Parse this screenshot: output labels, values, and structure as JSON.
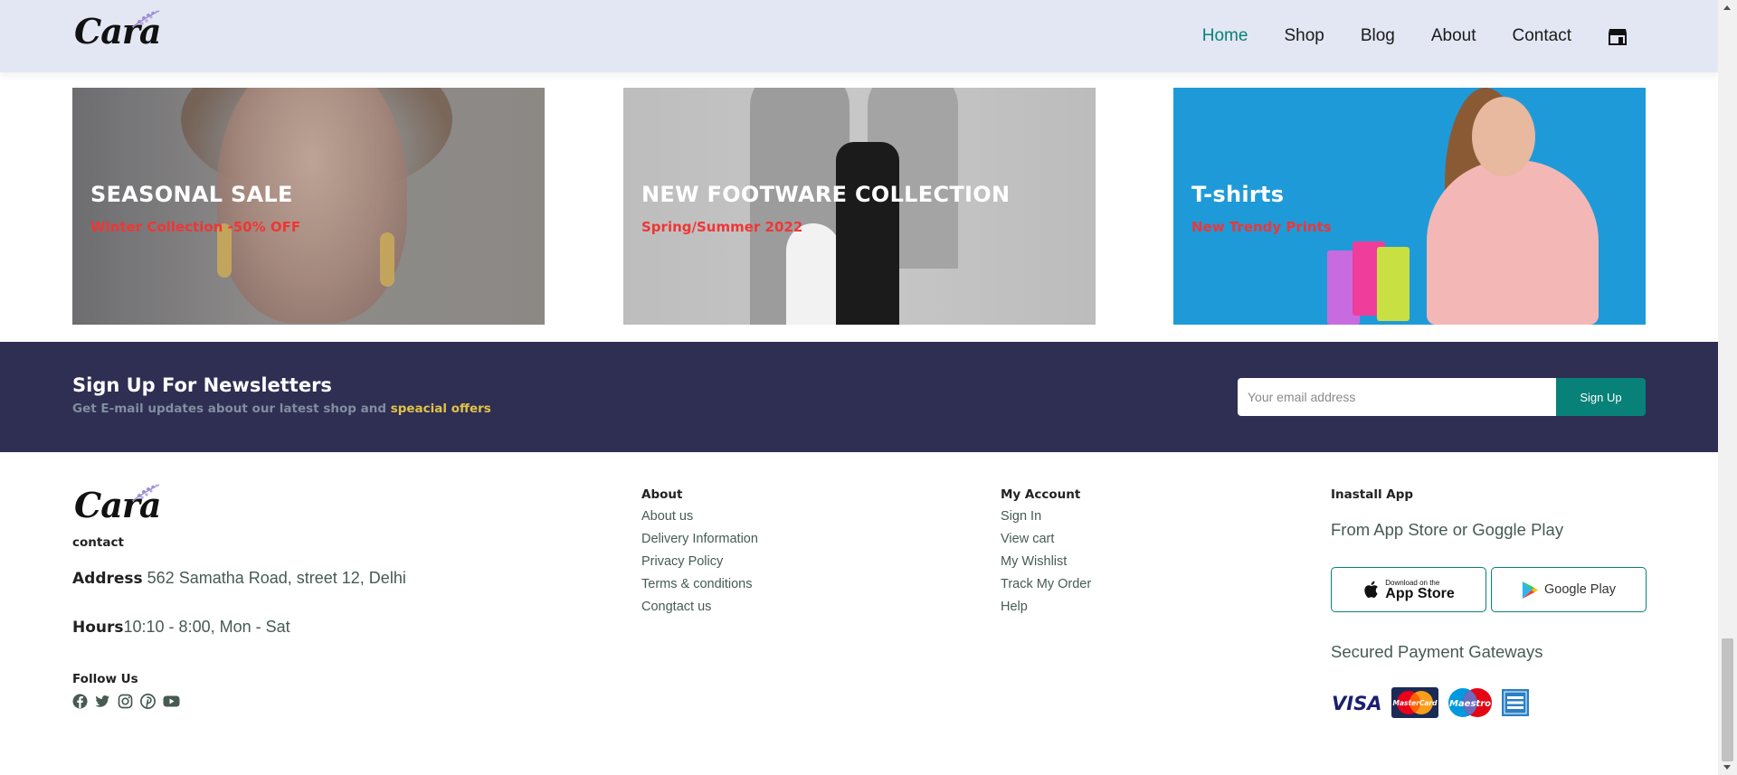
{
  "brand": {
    "logo_text": "Cara"
  },
  "nav": {
    "links": [
      "Home",
      "Shop",
      "Blog",
      "About",
      "Contact"
    ],
    "active": "Home",
    "cart_icon": "shop-icon",
    "accent": "#088178"
  },
  "banners": [
    {
      "title": "SEASONAL SALE",
      "subtitle": "Winter Collection -50% OFF"
    },
    {
      "title": "NEW FOOTWARE COLLECTION",
      "subtitle": "Spring/Summer 2022"
    },
    {
      "title": "T-shirts",
      "subtitle": "New Trendy Prints"
    }
  ],
  "newsletter": {
    "title": "Sign Up For Newsletters",
    "subtitle_prefix": "Get E-mail updates about our latest shop and ",
    "subtitle_highlight": "speacial offers",
    "input_placeholder": "Your email address",
    "button_label": "Sign Up",
    "bg_color": "#2f2e53"
  },
  "footer": {
    "contact_heading": "contact",
    "address_label": "Address",
    "address_value": " 562 Samatha Road, street 12, Delhi",
    "hours_label": "Hours",
    "hours_value": "10:10 - 8:00, Mon - Sat",
    "follow_heading": "Follow Us",
    "social_icons": [
      "facebook-icon",
      "twitter-icon",
      "instagram-icon",
      "pinterest-icon",
      "youtube-icon"
    ],
    "about": {
      "heading": "About",
      "links": [
        "About us",
        "Delivery Information",
        "Privacy Policy",
        "Terms & conditions",
        "Congtact us"
      ]
    },
    "account": {
      "heading": "My Account",
      "links": [
        "Sign In",
        "View cart",
        "My Wishlist",
        "Track My Order",
        "Help"
      ]
    },
    "install": {
      "heading": "Inastall App",
      "subtitle": "From App Store or Goggle Play",
      "app_store_small": "Download on the",
      "app_store_big": "App Store",
      "google_play": "Google Play",
      "secured_label": "Secured Payment Gateways",
      "payment_icons": [
        "visa-icon",
        "mastercard-icon",
        "maestro-icon",
        "amex-icon"
      ],
      "visa_text": "VISA",
      "mastercard_text": "MasterCard",
      "maestro_text": "Maestro"
    }
  }
}
